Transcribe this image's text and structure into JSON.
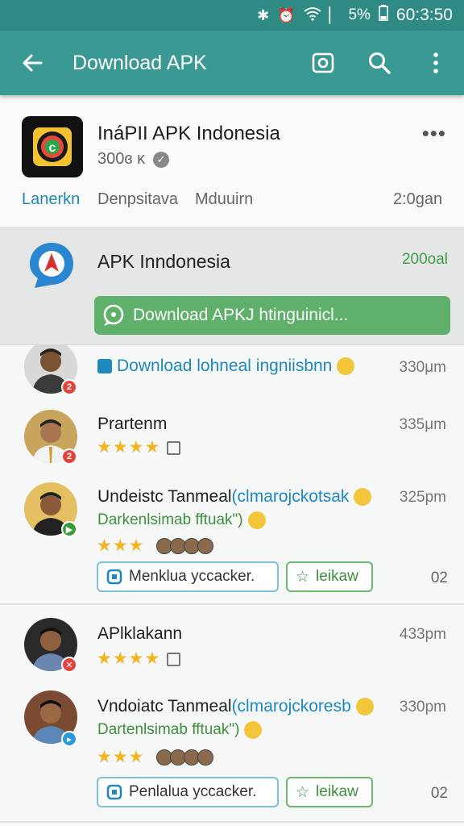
{
  "status": {
    "battery": "5%",
    "time": "60:3:50"
  },
  "appbar": {
    "title": "Download APK"
  },
  "app": {
    "name": "InáPII APK Indonesia",
    "meta": "300ɞ ᴋ",
    "tabs": [
      "Lanerkn",
      "Denpsitava",
      "Mduuirn",
      "2:0gan"
    ]
  },
  "featured": {
    "title": "APK Inndonesia",
    "count": "200oal",
    "button_label": "Download APKJ htinguinicl..."
  },
  "comments": [
    {
      "name": "Download lohneal ingniisbnn",
      "time": "330μm"
    },
    {
      "name": "Prartenm",
      "time": "335μm",
      "stars": "★★★★"
    },
    {
      "name": "Undeistc Tanmeal",
      "name_extra": "(clmarojckotsak",
      "line2": "Darkenlsimab fftuak\")",
      "time": "325pm",
      "stars": "★★★",
      "reply_label": "Menklua yccacker.",
      "like_label": "leikaw",
      "count": "02"
    },
    {
      "name": "APlklakann",
      "time": "433pm",
      "stars": "★★★★"
    },
    {
      "name": "Vndoiatc Tanmeal",
      "name_extra": "(clmarojckoresb",
      "line2": "Dartenlsimab fftuak\")",
      "time": "330pm",
      "stars": "★★★",
      "reply_label": "Penlalua yccacker.",
      "like_label": "leikaw",
      "count": "02"
    }
  ],
  "colors": {
    "appbar": "#3a9993",
    "statusbar": "#2f8a84",
    "accent_green": "#5fb06a",
    "link_blue": "#1e88c0"
  }
}
